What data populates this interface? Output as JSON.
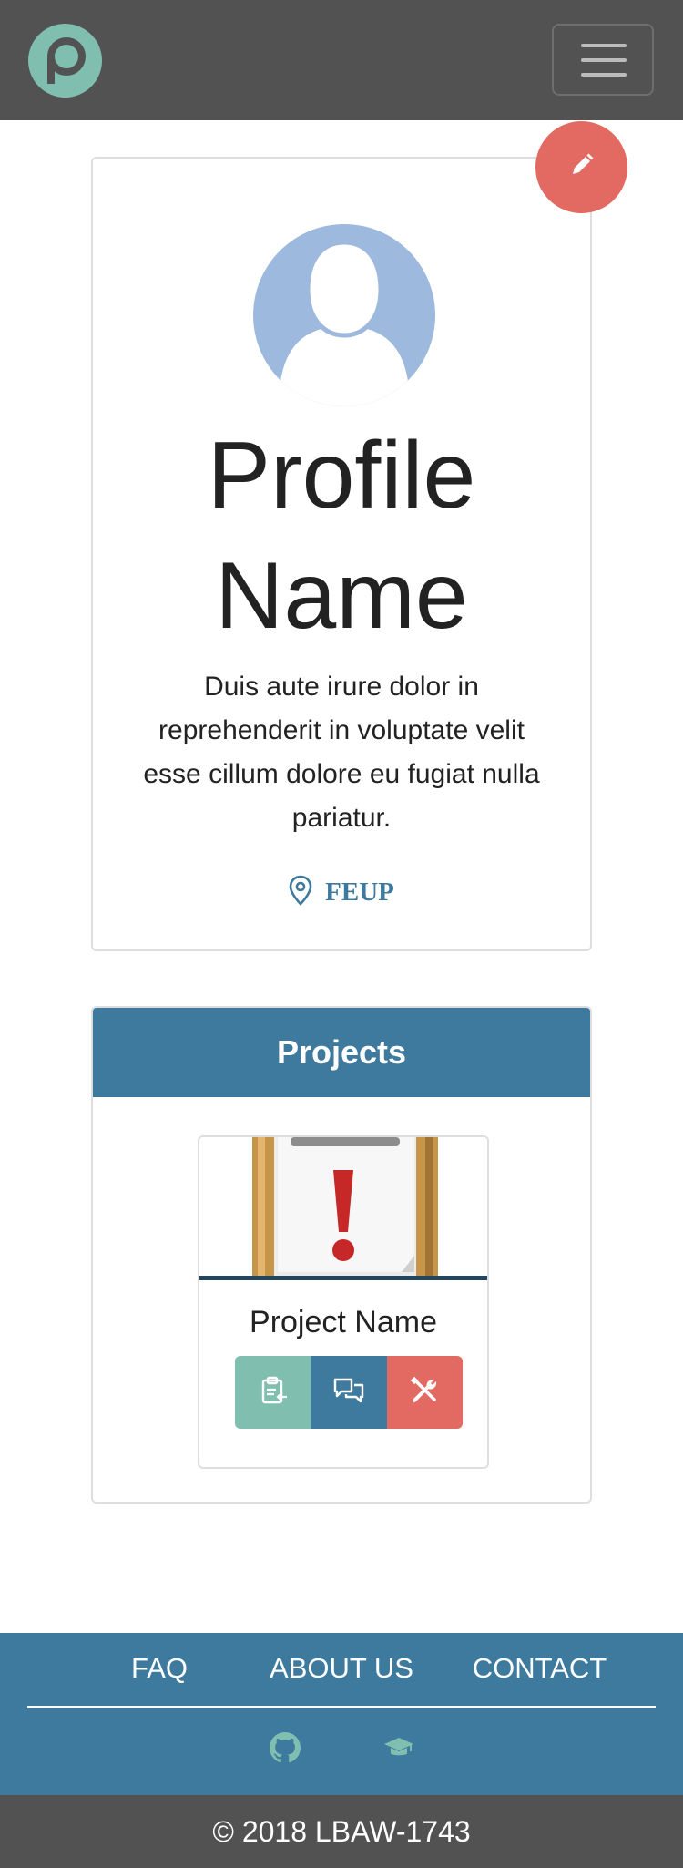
{
  "navbar": {
    "logo_icon": "p-logo-icon",
    "menu_icon": "hamburger-menu-icon"
  },
  "profile": {
    "edit_icon": "pencil-icon",
    "avatar_icon": "user-avatar-icon",
    "name_line1": "Profile",
    "name_line2": "Name",
    "bio": "Duis aute irure dolor in reprehenderit in voluptate velit esse cillum dolore eu fugiat nulla pariatur.",
    "location_icon": "map-pin-icon",
    "location": "FEUP"
  },
  "projects": {
    "title": "Projects",
    "items": [
      {
        "name": "Project Name",
        "thumb_icon": "clipboard-warning-image",
        "actions": [
          {
            "icon": "clipboard-icon",
            "color": "#80bfb0"
          },
          {
            "icon": "chat-bubbles-icon",
            "color": "#3e7a9e"
          },
          {
            "icon": "tools-icon",
            "color": "#e36a62"
          }
        ]
      }
    ]
  },
  "footer": {
    "links": [
      "FAQ",
      "ABOUT US",
      "CONTACT"
    ],
    "icons": [
      "github-icon",
      "graduation-cap-icon"
    ],
    "copyright": "© 2018 LBAW-1743"
  },
  "colors": {
    "dark": "#525252",
    "blue": "#3e7a9e",
    "teal": "#80bfb0",
    "red": "#e36a62",
    "avatar": "#9db9dd"
  }
}
